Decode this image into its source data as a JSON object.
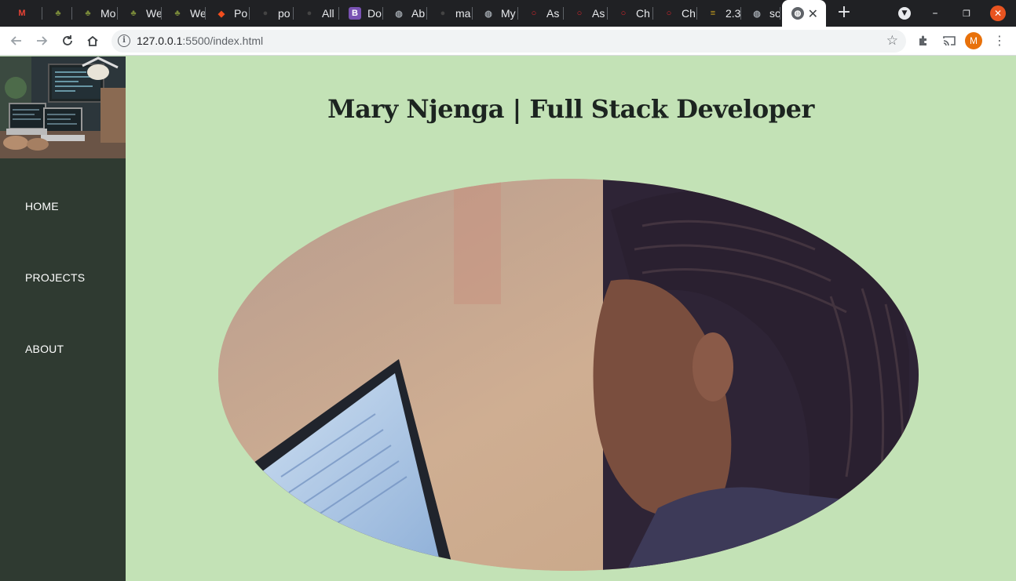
{
  "browser": {
    "tabs": [
      {
        "title": "",
        "icon": "gmail-icon",
        "color": "#ea4335"
      },
      {
        "title": "",
        "icon": "tree-icon",
        "color": "#7a8b3a"
      },
      {
        "title": "Mo",
        "icon": "tree-icon",
        "color": "#7a8b3a"
      },
      {
        "title": "We",
        "icon": "tree-icon",
        "color": "#7a8b3a"
      },
      {
        "title": "We",
        "icon": "tree-icon",
        "color": "#7a8b3a"
      },
      {
        "title": "Po",
        "icon": "figma-icon",
        "color": "#f24e1e"
      },
      {
        "title": "po",
        "icon": "github-icon",
        "color": "#444444"
      },
      {
        "title": "All",
        "icon": "github-icon",
        "color": "#444444"
      },
      {
        "title": "Do",
        "icon": "bootstrap-icon",
        "color": "#7952b3"
      },
      {
        "title": "Ab",
        "icon": "globe-icon",
        "color": "#9aa0a6"
      },
      {
        "title": "ma",
        "icon": "github-icon",
        "color": "#444444"
      },
      {
        "title": "My",
        "icon": "globe-icon",
        "color": "#9aa0a6"
      },
      {
        "title": "As",
        "icon": "ring-icon",
        "color": "#e0262d"
      },
      {
        "title": "As",
        "icon": "ring-icon",
        "color": "#e0262d"
      },
      {
        "title": "Ch",
        "icon": "ring-icon",
        "color": "#e0262d"
      },
      {
        "title": "Ch",
        "icon": "ring-icon",
        "color": "#e0262d"
      },
      {
        "title": "2.3",
        "icon": "stripes-icon",
        "color": "#c8a020"
      },
      {
        "title": "scr",
        "icon": "globe-icon",
        "color": "#9aa0a6"
      }
    ],
    "active_tab": {
      "title": "",
      "icon": "globe-icon"
    },
    "url_host": "127.0.0.1",
    "url_rest": ":5500/index.html",
    "profile_initial": "M"
  },
  "page": {
    "title": "Mary Njenga | Full Stack Developer",
    "nav": [
      {
        "label": "HOME"
      },
      {
        "label": "PROJECTS"
      },
      {
        "label": "ABOUT"
      }
    ],
    "colors": {
      "background": "#c3e2b6",
      "sidebar": "#2f3a31",
      "nav_text": "#ffffff",
      "title_text": "#1c2420"
    }
  }
}
